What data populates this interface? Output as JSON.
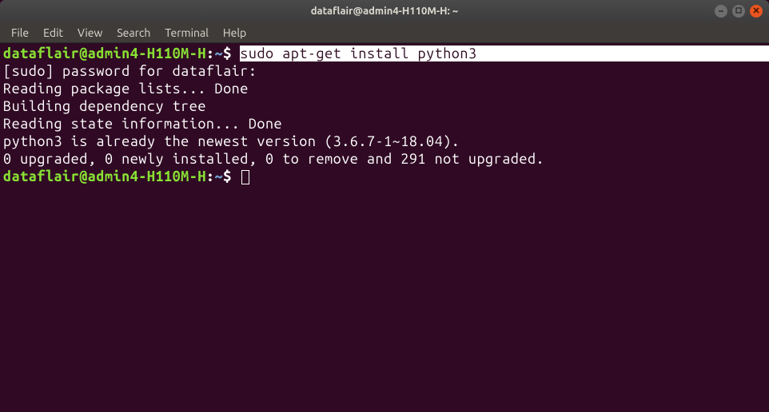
{
  "window": {
    "title": "dataflair@admin4-H110M-H: ~"
  },
  "menubar": {
    "items": [
      "File",
      "Edit",
      "View",
      "Search",
      "Terminal",
      "Help"
    ]
  },
  "prompt1": {
    "user_host": "dataflair@admin4-H110M-H",
    "sep": ":",
    "path": "~",
    "dollar": "$ ",
    "command": "sudo apt-get install python3"
  },
  "output": {
    "l1": "[sudo] password for dataflair: ",
    "l2": "Reading package lists... Done",
    "l3": "Building dependency tree       ",
    "l4": "Reading state information... Done",
    "l5": "python3 is already the newest version (3.6.7-1~18.04).",
    "l6": "0 upgraded, 0 newly installed, 0 to remove and 291 not upgraded."
  },
  "prompt2": {
    "user_host": "dataflair@admin4-H110M-H",
    "sep": ":",
    "path": "~",
    "dollar": "$ "
  }
}
